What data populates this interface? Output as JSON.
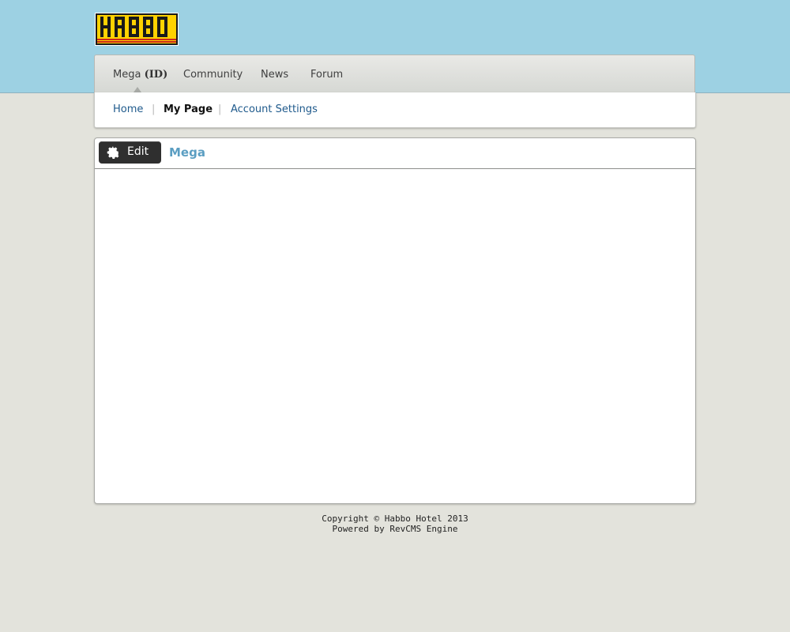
{
  "logo": {
    "text": "HABBO",
    "colors": {
      "fill": "#ffd200",
      "outline": "#1a1a1a",
      "stripe": "#c8281e"
    }
  },
  "mainnav": {
    "items": [
      {
        "label": "Mega",
        "suffix": "(ID)",
        "active": true
      },
      {
        "label": "Community"
      },
      {
        "label": "News"
      },
      {
        "label": "Forum"
      }
    ]
  },
  "subnav": {
    "items": [
      {
        "label": "Home"
      },
      {
        "label": "My Page",
        "active": true
      },
      {
        "label": "Account Settings"
      }
    ],
    "separator": "|"
  },
  "panel": {
    "edit_label": "Edit",
    "edit_icon": "gear-icon",
    "title": "Mega"
  },
  "footer": {
    "line1": "Copyright © Habbo Hotel 2013",
    "line2": "Powered by RevCMS Engine"
  },
  "colors": {
    "background": "#e3e3dc",
    "header_band": "#9dd1e3",
    "link": "#1f5a8c",
    "panel_title": "#5b9ec2",
    "edit_button": "#2f2f2f"
  }
}
